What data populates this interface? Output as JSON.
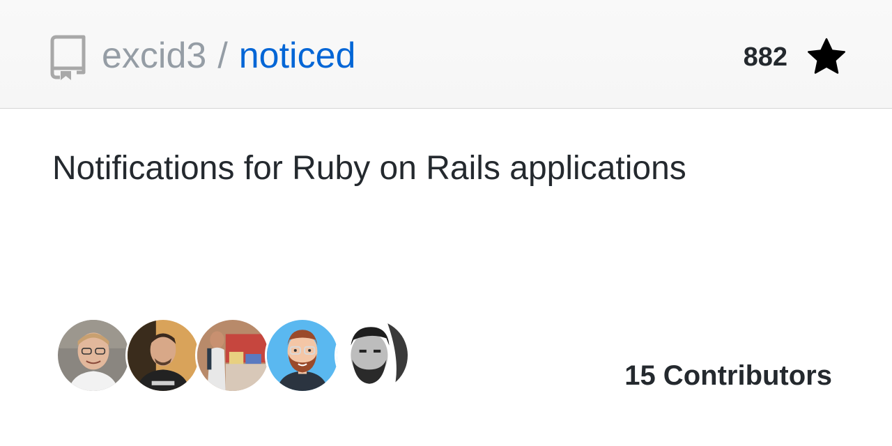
{
  "header": {
    "owner": "excid3",
    "separator": "/",
    "repo_name": "noticed",
    "star_count": "882",
    "star_icon": "star-icon",
    "repo_icon": "repo-icon"
  },
  "description": "Notifications for Ruby on Rails applications",
  "contributors": {
    "label": "15 Contributors",
    "avatars": [
      {
        "name": "avatar-1",
        "kind": "photo"
      },
      {
        "name": "avatar-2",
        "kind": "photo"
      },
      {
        "name": "avatar-3",
        "kind": "photo"
      },
      {
        "name": "avatar-4",
        "kind": "illustration"
      },
      {
        "name": "avatar-5",
        "kind": "photo"
      }
    ]
  },
  "colors": {
    "link": "#0366d6",
    "muted": "#959da5",
    "text": "#24292e",
    "header_bg": "#f7f7f7",
    "avatar_illustration_bg": "#5ab8f0"
  }
}
